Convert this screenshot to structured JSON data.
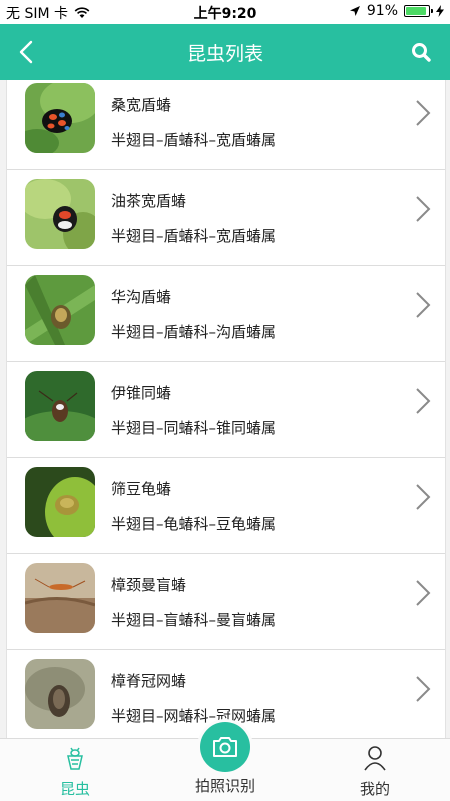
{
  "status_bar": {
    "carrier": "无 SIM 卡",
    "time": "上午9:20",
    "battery": "91%",
    "battery_level": 0.91
  },
  "header": {
    "title": "昆虫列表",
    "background_color": "#28bfa0"
  },
  "insects": [
    {
      "name": "桑宽盾蝽",
      "taxonomy": "半翅目–盾蝽科–宽盾蝽属"
    },
    {
      "name": "油茶宽盾蝽",
      "taxonomy": "半翅目–盾蝽科–宽盾蝽属"
    },
    {
      "name": "华沟盾蝽",
      "taxonomy": "半翅目–盾蝽科–沟盾蝽属"
    },
    {
      "name": "伊锥同蝽",
      "taxonomy": "半翅目–同蝽科–锥同蝽属"
    },
    {
      "name": "筛豆龟蝽",
      "taxonomy": "半翅目–龟蝽科–豆龟蝽属"
    },
    {
      "name": "樟颈曼盲蝽",
      "taxonomy": "半翅目–盲蝽科–曼盲蝽属"
    },
    {
      "name": "樟脊冠网蝽",
      "taxonomy": "半翅目–网蝽科–冠网蝽属"
    }
  ],
  "tab_bar": {
    "tabs": [
      {
        "label": "昆虫",
        "icon": "insect-icon",
        "active": true
      },
      {
        "label": "拍照识别",
        "icon": "camera-icon",
        "active": false
      },
      {
        "label": "我的",
        "icon": "person-icon",
        "active": false
      }
    ]
  },
  "accent_color": "#28bfa0"
}
